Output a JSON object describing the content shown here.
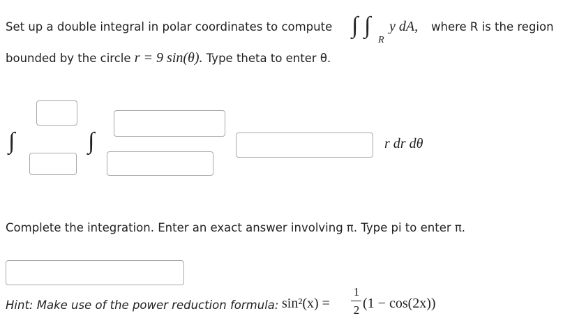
{
  "problem": {
    "line1_prefix": "Set up a double integral in polar coordinates to compute",
    "integrand_label": "y dA,",
    "region_sub": "R",
    "line1_suffix": "where R is the region",
    "line2_prefix": "bounded by the circle",
    "circle_eq": "r = 9 sin(θ).",
    "line2_suffix": "Type theta to enter θ.",
    "differential": "r dr dθ"
  },
  "inputs": {
    "outer_upper": "",
    "outer_lower": "",
    "inner_upper": "",
    "inner_lower": "",
    "integrand": "",
    "answer": ""
  },
  "part2": {
    "instruction": "Complete the integration. Enter an exact answer involving π. Type pi to enter π."
  },
  "hint": {
    "text": "Hint: Make use of the power reduction formula:",
    "lhs": "sin²(x) =",
    "frac_num": "1",
    "frac_den": "2",
    "rhs": "(1 − cos(2x))"
  }
}
